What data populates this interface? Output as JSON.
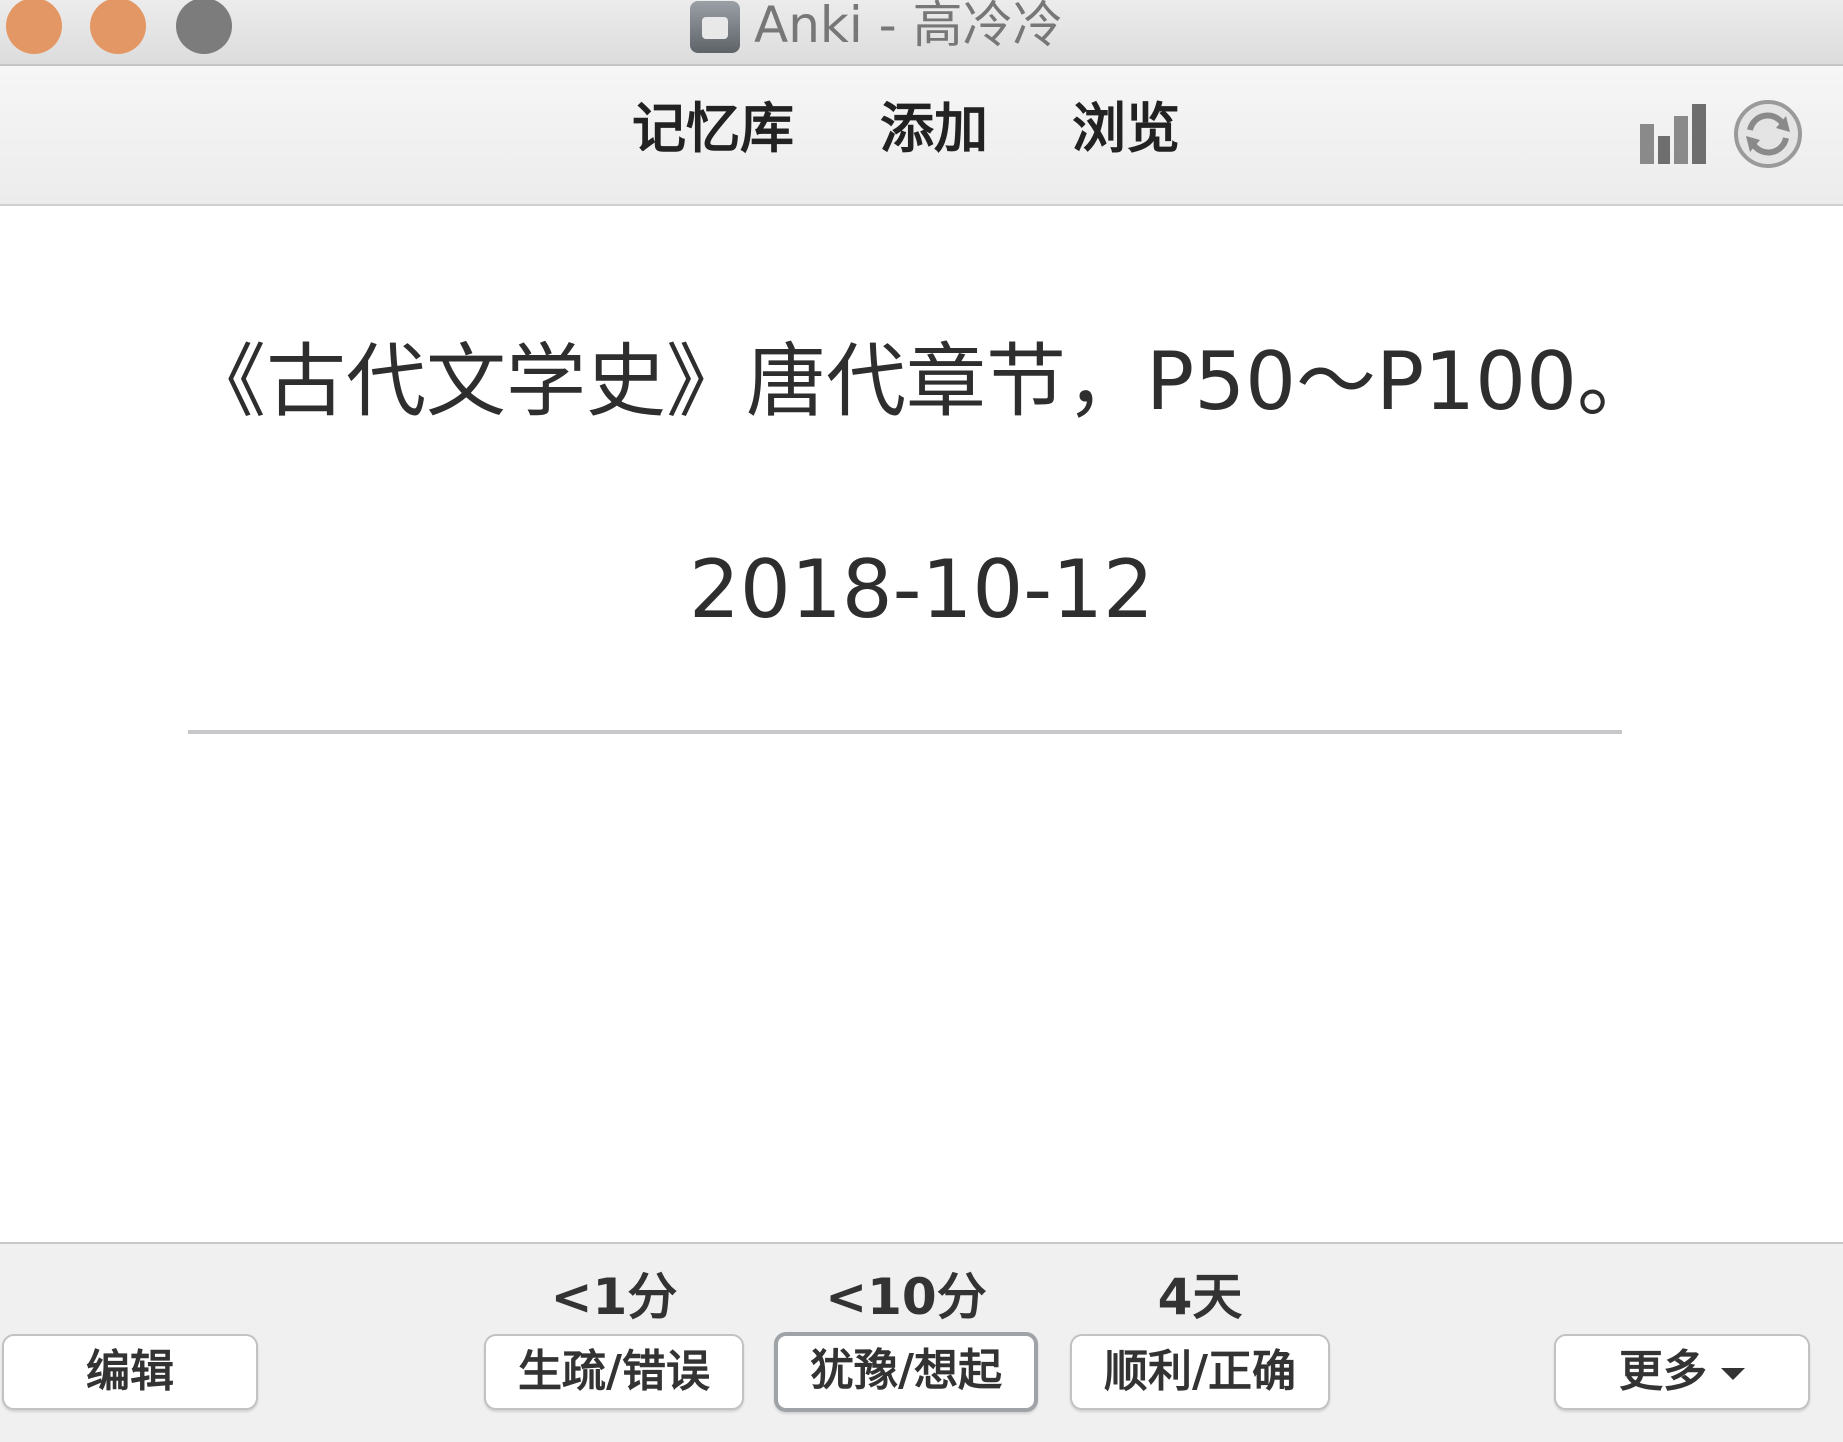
{
  "window": {
    "title": "Anki - 高冷冷",
    "traffic_lights": [
      "#e39764",
      "#e39764",
      "#7c7c7c"
    ]
  },
  "toolbar": {
    "decks_label": "记忆库",
    "add_label": "添加",
    "browse_label": "浏览",
    "stats_icon": "bar-chart-icon",
    "sync_icon": "sync-icon"
  },
  "card": {
    "front_text": "《古代文学史》唐代章节，P50～P100。",
    "date_text": "2018-10-12"
  },
  "bottombar": {
    "edit_label": "编辑",
    "answers": [
      {
        "interval": "<1分",
        "label": "生疏/错误"
      },
      {
        "interval": "<10分",
        "label": "犹豫/想起"
      },
      {
        "interval": "4天",
        "label": "顺利/正确"
      }
    ],
    "more_label": "更多"
  }
}
